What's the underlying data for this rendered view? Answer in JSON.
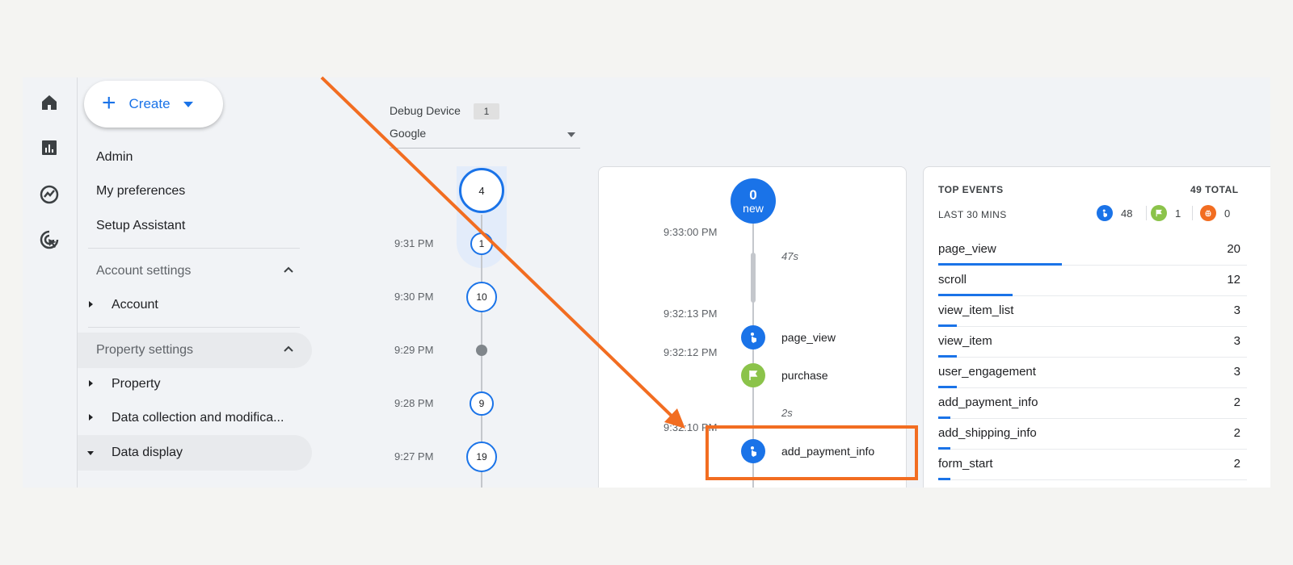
{
  "nav": {
    "create_label": "Create",
    "items": [
      "Admin",
      "My preferences",
      "Setup Assistant"
    ],
    "account_settings": "Account settings",
    "account": "Account",
    "property_settings": "Property settings",
    "property": "Property",
    "data_collection": "Data collection and modifica...",
    "data_display": "Data display"
  },
  "debug": {
    "label": "Debug Device",
    "count": "1",
    "device": "Google"
  },
  "minutes": [
    {
      "time": "",
      "count": "4"
    },
    {
      "time": "9:31 PM",
      "count": "1"
    },
    {
      "time": "9:30 PM",
      "count": "10"
    },
    {
      "time": "9:29 PM",
      "count": ""
    },
    {
      "time": "9:28 PM",
      "count": "9"
    },
    {
      "time": "9:27 PM",
      "count": "19"
    }
  ],
  "seconds": {
    "new_count": "0",
    "new_label": "new",
    "times": [
      "9:33:00 PM",
      "9:32:13 PM",
      "9:32:12 PM",
      "9:32:10 PM"
    ],
    "gaps": [
      "47s",
      "2s"
    ],
    "events": [
      "page_view",
      "purchase",
      "add_payment_info"
    ]
  },
  "top_events": {
    "title": "TOP EVENTS",
    "total": "49 TOTAL",
    "subtitle": "LAST 30 MINS",
    "counts": {
      "events": "48",
      "conversions": "1",
      "errors": "0"
    },
    "rows": [
      {
        "name": "page_view",
        "count": "20",
        "fraction": 0.4
      },
      {
        "name": "scroll",
        "count": "12",
        "fraction": 0.24
      },
      {
        "name": "view_item_list",
        "count": "3",
        "fraction": 0.06
      },
      {
        "name": "view_item",
        "count": "3",
        "fraction": 0.06
      },
      {
        "name": "user_engagement",
        "count": "3",
        "fraction": 0.06
      },
      {
        "name": "add_payment_info",
        "count": "2",
        "fraction": 0.04
      },
      {
        "name": "add_shipping_info",
        "count": "2",
        "fraction": 0.04
      },
      {
        "name": "form_start",
        "count": "2",
        "fraction": 0.04
      }
    ]
  },
  "colors": {
    "accent_blue": "#1a73e8",
    "conversion_green": "#8bc34a",
    "error_orange": "#f26d21",
    "annotation_orange": "#f26d21"
  },
  "icons": [
    "home-icon",
    "reports-icon",
    "explore-icon",
    "advertising-icon"
  ]
}
